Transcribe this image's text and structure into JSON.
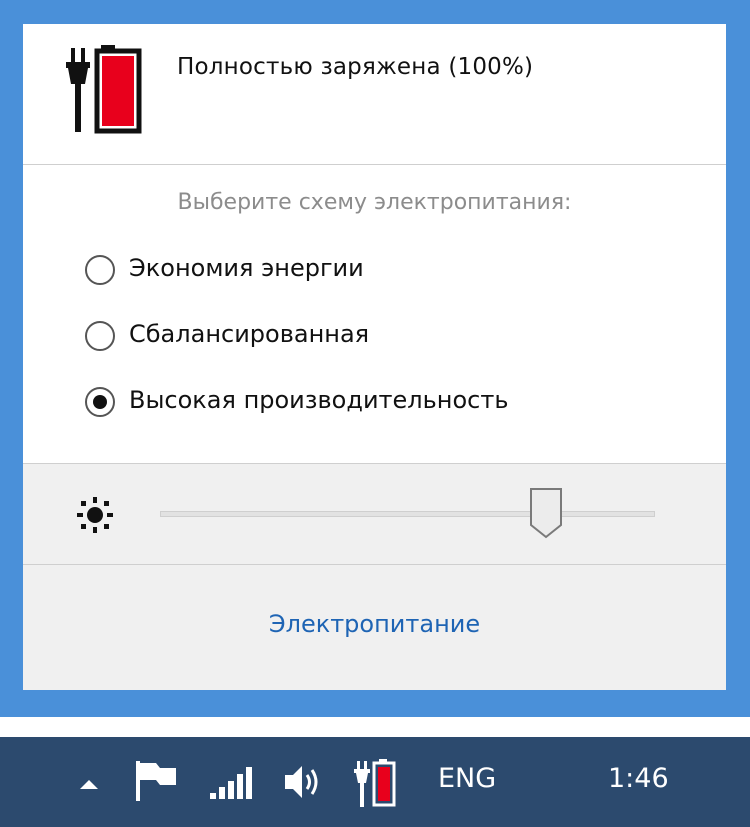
{
  "battery": {
    "status_text": "Полностью заряжена (100%)",
    "level_fraction": 1.0,
    "plugged_in": true
  },
  "power_plans": {
    "prompt": "Выберите схему электропитания:",
    "options": [
      {
        "label": "Экономия энергии",
        "selected": false
      },
      {
        "label": "Сбалансированная",
        "selected": false
      },
      {
        "label": "Высокая производительность",
        "selected": true
      }
    ]
  },
  "brightness": {
    "icon": "sun-icon",
    "level_fraction": 0.78
  },
  "footer": {
    "link_label": "Электропитание"
  },
  "taskbar": {
    "icons": [
      "show-hidden-icons-arrow",
      "action-center-flag-icon",
      "network-signal-icon",
      "volume-icon",
      "battery-plugged-icon"
    ],
    "language": "ENG",
    "clock": "1:46"
  },
  "colors": {
    "flyout_border": "#4a90d9",
    "battery_fill": "#e8001c",
    "link": "#1e64b4",
    "taskbar": "#2c4a6e"
  }
}
